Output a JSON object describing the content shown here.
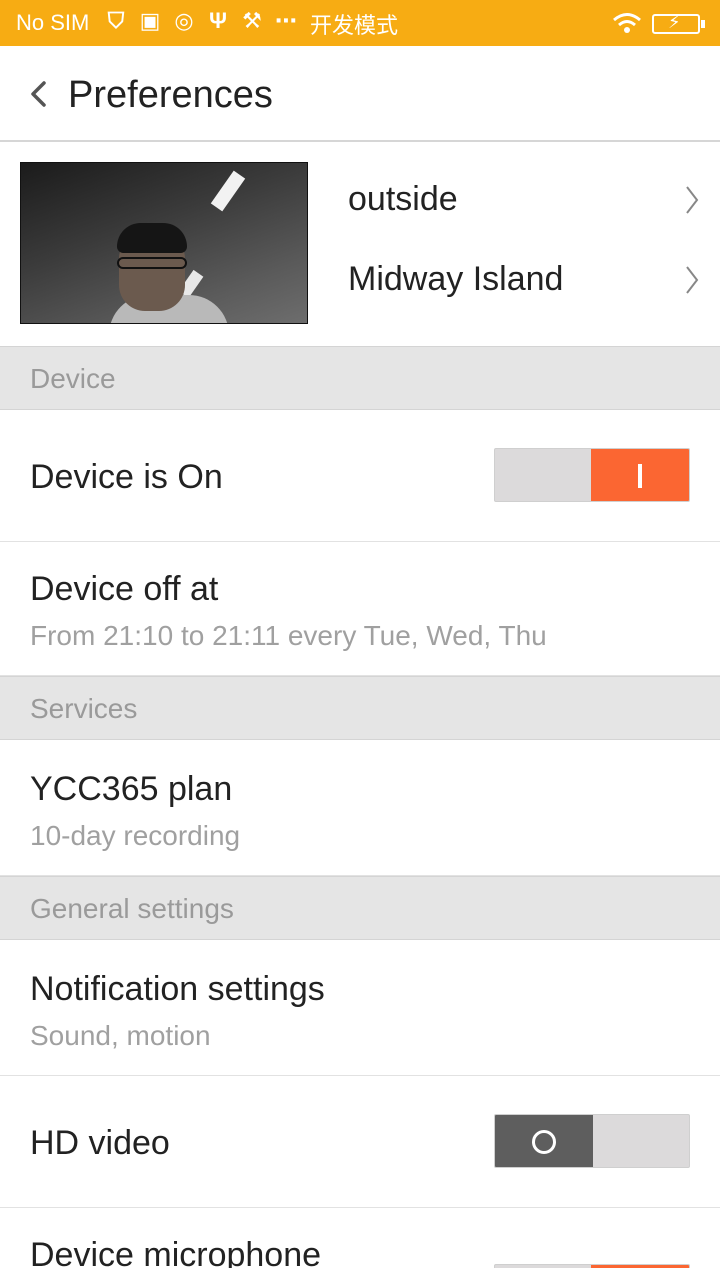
{
  "status_bar": {
    "carrier": "No SIM",
    "icons": [
      "shield-icon",
      "photo-icon",
      "target-icon",
      "usb-icon",
      "tools-icon",
      "more-icon"
    ],
    "dev_mode": "开发模式",
    "background": "#f7ac13"
  },
  "nav": {
    "title": "Preferences"
  },
  "camera": {
    "name": "outside",
    "timezone": "Midway Island"
  },
  "sections": {
    "device": "Device",
    "services": "Services",
    "general": "General settings"
  },
  "items": {
    "device_on": {
      "label": "Device is On",
      "toggle": true
    },
    "device_off_at": {
      "label": "Device off at",
      "sub": "From 21:10 to 21:11 every Tue, Wed, Thu"
    },
    "plan": {
      "label": "YCC365 plan",
      "sub": "10-day recording"
    },
    "notifications": {
      "label": "Notification settings",
      "sub": "Sound, motion"
    },
    "hd_video": {
      "label": "HD video",
      "toggle": false
    },
    "microphone": {
      "label": "Device microphone",
      "toggle": true
    }
  },
  "colors": {
    "accent": "#fb6632",
    "section_bg": "#e5e5e5",
    "toggle_off_knob": "#5e5e5e"
  }
}
